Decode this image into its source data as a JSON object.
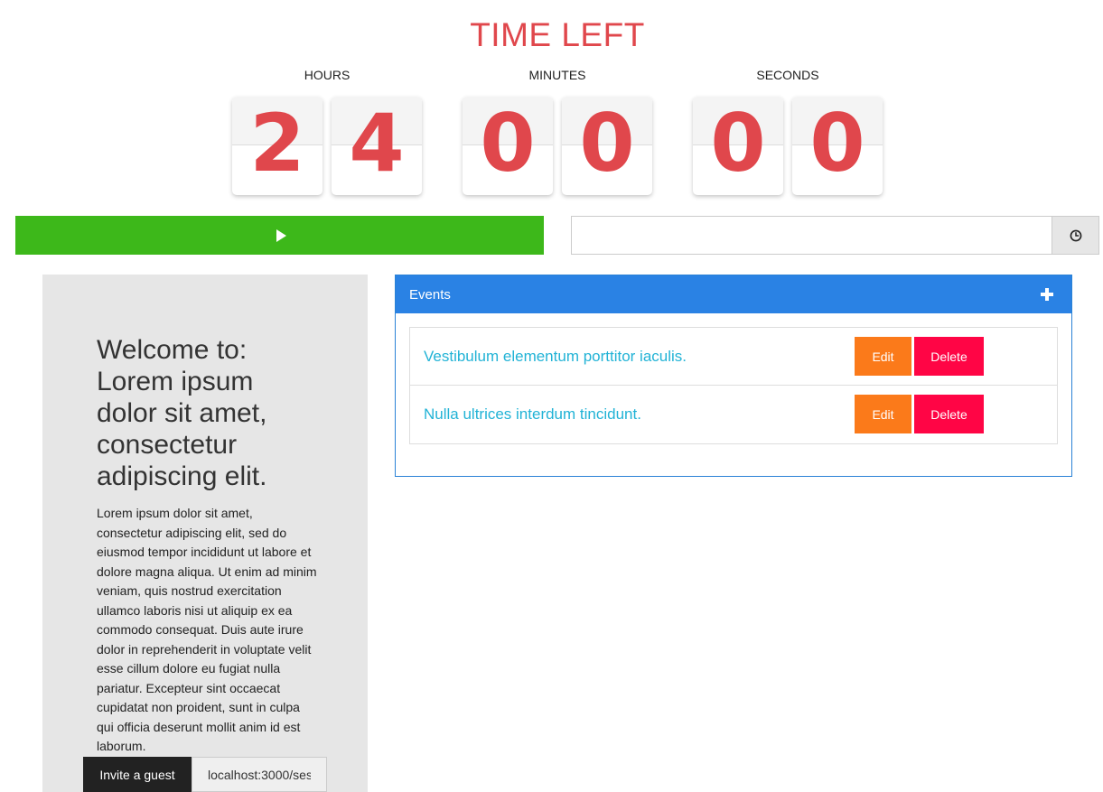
{
  "countdown": {
    "title": "TIME LEFT",
    "units": [
      {
        "label": "HOURS",
        "digits": [
          "2",
          "4"
        ]
      },
      {
        "label": "MINUTES",
        "digits": [
          "0",
          "0"
        ]
      },
      {
        "label": "SECONDS",
        "digits": [
          "0",
          "0"
        ]
      }
    ]
  },
  "controls": {
    "play_icon": "play-icon",
    "time_input_value": "",
    "time_addon_icon": "clock-icon"
  },
  "welcome": {
    "heading": "Welcome to: Lorem ipsum dolor sit amet, consectetur adipiscing elit.",
    "body": "Lorem ipsum dolor sit amet, consectetur adipiscing elit, sed do eiusmod tempor incididunt ut labore et dolore magna aliqua. Ut enim ad minim veniam, quis nostrud exercitation ullamco laboris nisi ut aliquip ex ea commodo consequat. Duis aute irure dolor in reprehenderit in voluptate velit esse cillum dolore eu fugiat nulla pariatur. Excepteur sint occaecat cupidatat non proident, sunt in culpa qui officia deserunt mollit anim id est laborum.",
    "invite_button_label": "Invite a guest",
    "invite_link_value": "localhost:3000/ses"
  },
  "events": {
    "heading": "Events",
    "add_icon": "plus-icon",
    "items": [
      {
        "title": "Vestibulum elementum porttitor iaculis.",
        "edit_label": "Edit",
        "delete_label": "Delete"
      },
      {
        "title": "Nulla ultrices interdum tincidunt.",
        "edit_label": "Edit",
        "delete_label": "Delete"
      }
    ]
  },
  "colors": {
    "accent_red": "#e0474c",
    "play_green": "#3db81a",
    "events_blue": "#2a82e4",
    "edit_orange": "#fb7a1a",
    "delete_red": "#ff0545",
    "link_cyan": "#22b3d6"
  }
}
